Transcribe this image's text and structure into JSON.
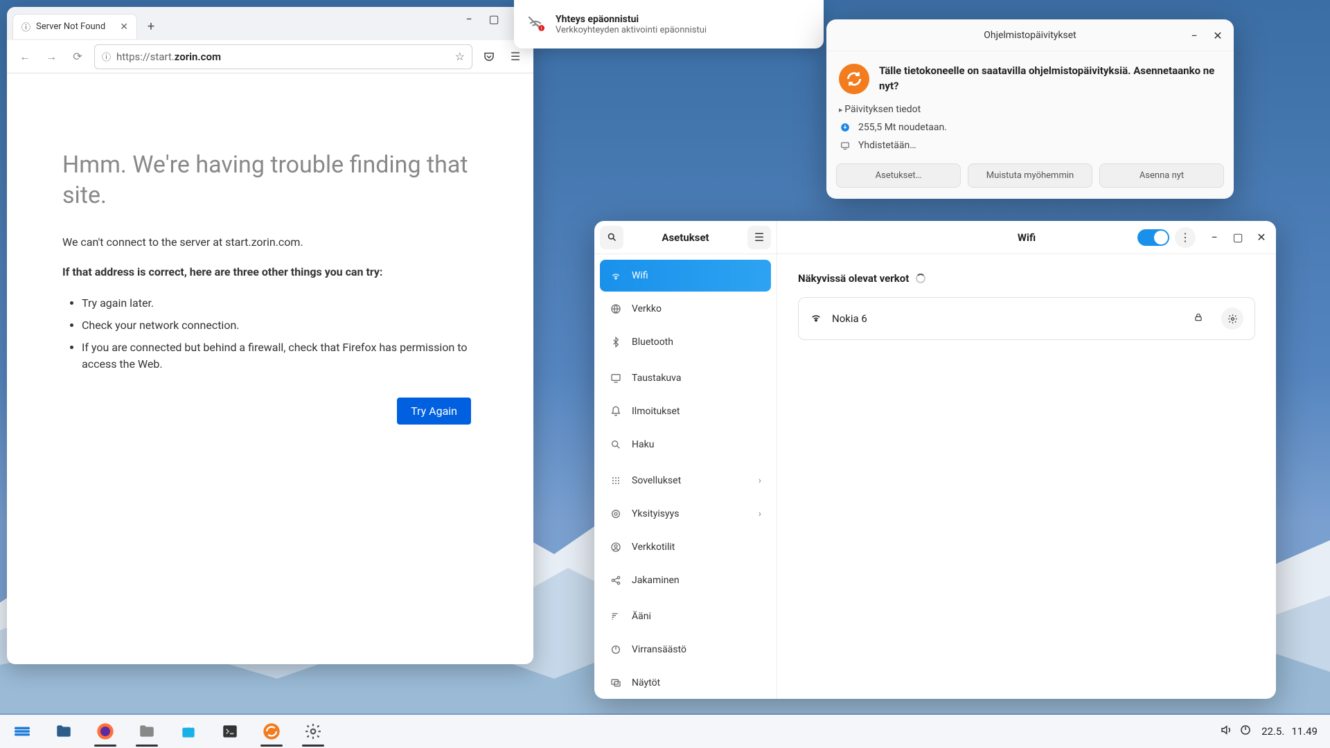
{
  "browser": {
    "tab_title": "Server Not Found",
    "url_prefix": "https://start.",
    "url_bold": "zorin.com",
    "page_heading": "Hmm. We're having trouble finding that site.",
    "cant_connect": "We can't connect to the server at start.zorin.com.",
    "if_correct": "If that address is correct, here are three other things you can try:",
    "bullets": [
      "Try again later.",
      "Check your network connection.",
      "If you are connected but behind a firewall, check that Firefox has permission to access the Web."
    ],
    "try_again": "Try Again"
  },
  "toast": {
    "title": "Yhteys epäonnistui",
    "subtitle": "Verkkoyhteyden aktivointi epäonnistui"
  },
  "updates": {
    "window_title": "Ohjelmistopäivitykset",
    "message": "Tälle tietokoneelle on saatavilla ohjelmistopäivityksiä. Asennetaanko ne nyt?",
    "details": "Päivityksen tiedot",
    "download": "255,5 Mt noudetaan.",
    "connecting": "Yhdistetään…",
    "btn_settings": "Asetukset…",
    "btn_later": "Muistuta myöhemmin",
    "btn_install": "Asenna nyt"
  },
  "settings": {
    "sidebar_title": "Asetukset",
    "items": [
      {
        "label": "Wifi"
      },
      {
        "label": "Verkko"
      },
      {
        "label": "Bluetooth"
      },
      {
        "label": "Taustakuva"
      },
      {
        "label": "Ilmoitukset"
      },
      {
        "label": "Haku"
      },
      {
        "label": "Sovellukset"
      },
      {
        "label": "Yksityisyys"
      },
      {
        "label": "Verkkotilit"
      },
      {
        "label": "Jakaminen"
      },
      {
        "label": "Ääni"
      },
      {
        "label": "Virransäästö"
      },
      {
        "label": "Näytöt"
      }
    ],
    "content_title": "Wifi",
    "visible_networks": "Näkyvissä olevat verkot",
    "network": "Nokia 6"
  },
  "taskbar": {
    "date": "22.5.",
    "time": "11.49"
  }
}
